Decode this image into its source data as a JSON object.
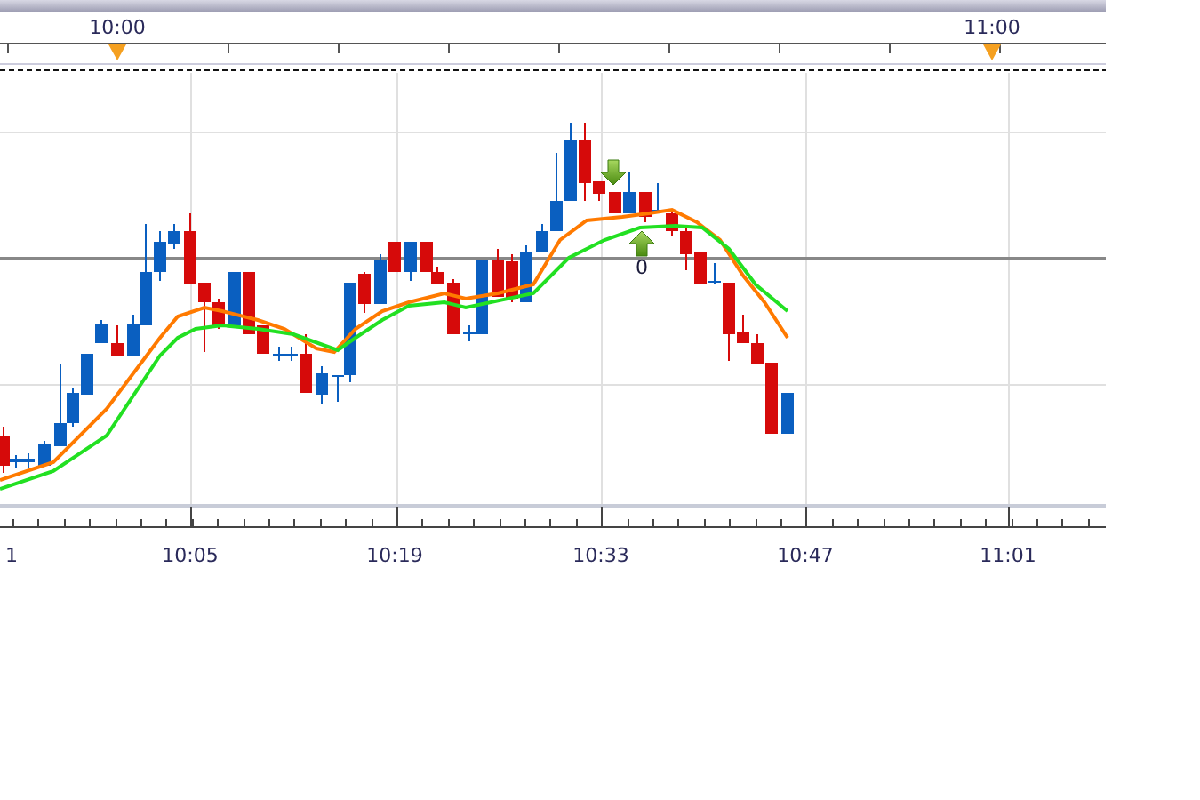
{
  "time_ruler": {
    "labels": [
      {
        "text": "10:00",
        "marked": true
      },
      {
        "text": "11:00",
        "marked": true
      }
    ]
  },
  "signals": [
    {
      "kind": "sell"
    },
    {
      "kind": "buy",
      "label": "0"
    }
  ],
  "x_axis": {
    "labels": [
      "1",
      "10:05",
      "10:19",
      "10:33",
      "10:47",
      "11:01"
    ]
  }
}
